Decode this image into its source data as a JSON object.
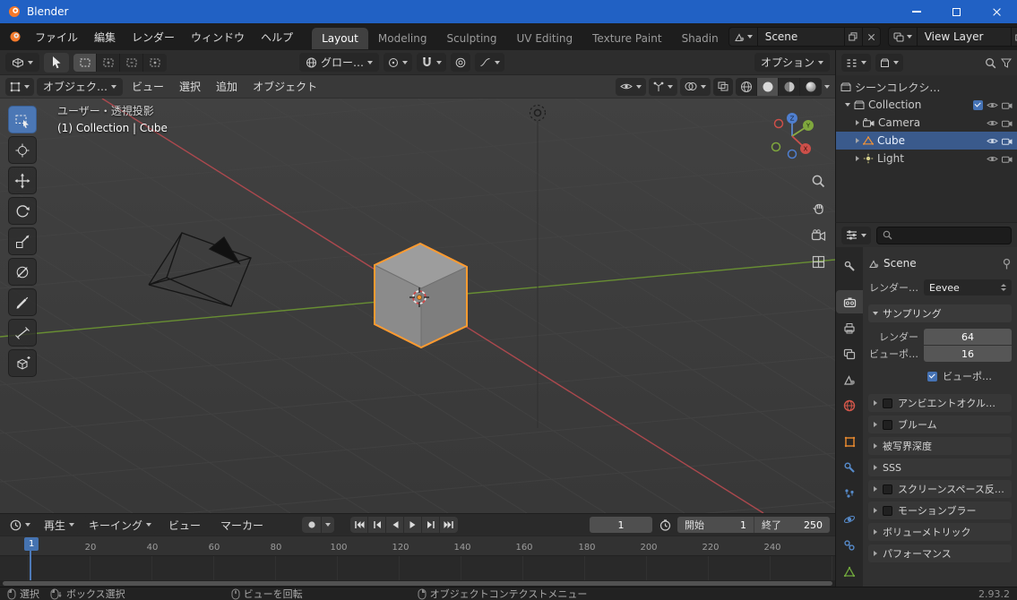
{
  "titlebar": {
    "title": "Blender"
  },
  "menubar": {
    "menus": [
      "ファイル",
      "編集",
      "レンダー",
      "ウィンドウ",
      "ヘルプ"
    ],
    "tabs": [
      {
        "label": "Layout"
      },
      {
        "label": "Modeling"
      },
      {
        "label": "Sculpting"
      },
      {
        "label": "UV Editing"
      },
      {
        "label": "Texture Paint"
      },
      {
        "label": "Shadin"
      }
    ],
    "scene_selector": {
      "value": "Scene"
    },
    "view_layer_selector": {
      "value": "View Layer"
    }
  },
  "tool_settings": {
    "orientation": "グロー…",
    "options": "オプション"
  },
  "viewport": {
    "mode": "オブジェク…",
    "menus": [
      "ビュー",
      "選択",
      "追加",
      "オブジェクト"
    ],
    "view_label": "ユーザー・透視投影",
    "context_label": "(1) Collection | Cube",
    "gizmo": {
      "x": "X",
      "y": "Y",
      "z": "Z"
    }
  },
  "outliner": {
    "root": "シーンコレクシ…",
    "items": [
      {
        "label": "Collection"
      },
      {
        "label": "Camera"
      },
      {
        "label": "Cube"
      },
      {
        "label": "Light"
      }
    ]
  },
  "properties": {
    "breadcrumb": "Scene",
    "engine_label": "レンダー…",
    "engine_value": "Eevee",
    "sampling": {
      "title": "サンプリング",
      "rows": [
        {
          "label": "レンダー",
          "value": "64"
        },
        {
          "label": "ビューポ…",
          "value": "16"
        }
      ],
      "checkbox_label": "ビューポ…"
    },
    "sections": [
      {
        "label": "アンビエントオクル…"
      },
      {
        "label": "ブルーム"
      },
      {
        "label": "被写界深度"
      },
      {
        "label": "SSS"
      },
      {
        "label": "スクリーンスペース反…"
      },
      {
        "label": "モーションブラー"
      },
      {
        "label": "ボリューメトリック"
      },
      {
        "label": "パフォーマンス"
      }
    ]
  },
  "timeline": {
    "playback": "再生",
    "keying": "キーイング",
    "menus": [
      "ビュー",
      "マーカー"
    ],
    "frame_current": "1",
    "start_label": "開始",
    "start_value": "1",
    "end_label": "終了",
    "end_value": "250",
    "ticks": [
      "20",
      "40",
      "60",
      "80",
      "100",
      "120",
      "140",
      "160",
      "180",
      "200",
      "220",
      "240"
    ],
    "marker": "1"
  },
  "statusbar": {
    "hints": [
      "選択",
      "ボックス選択",
      "ビューを回転",
      "オブジェクトコンテクストメニュー"
    ],
    "version": "2.93.2"
  },
  "colors": {
    "accent": "#4772b3",
    "selection": "#ff9b30",
    "axis_x": "#b84a50",
    "axis_y": "#6d9732"
  }
}
